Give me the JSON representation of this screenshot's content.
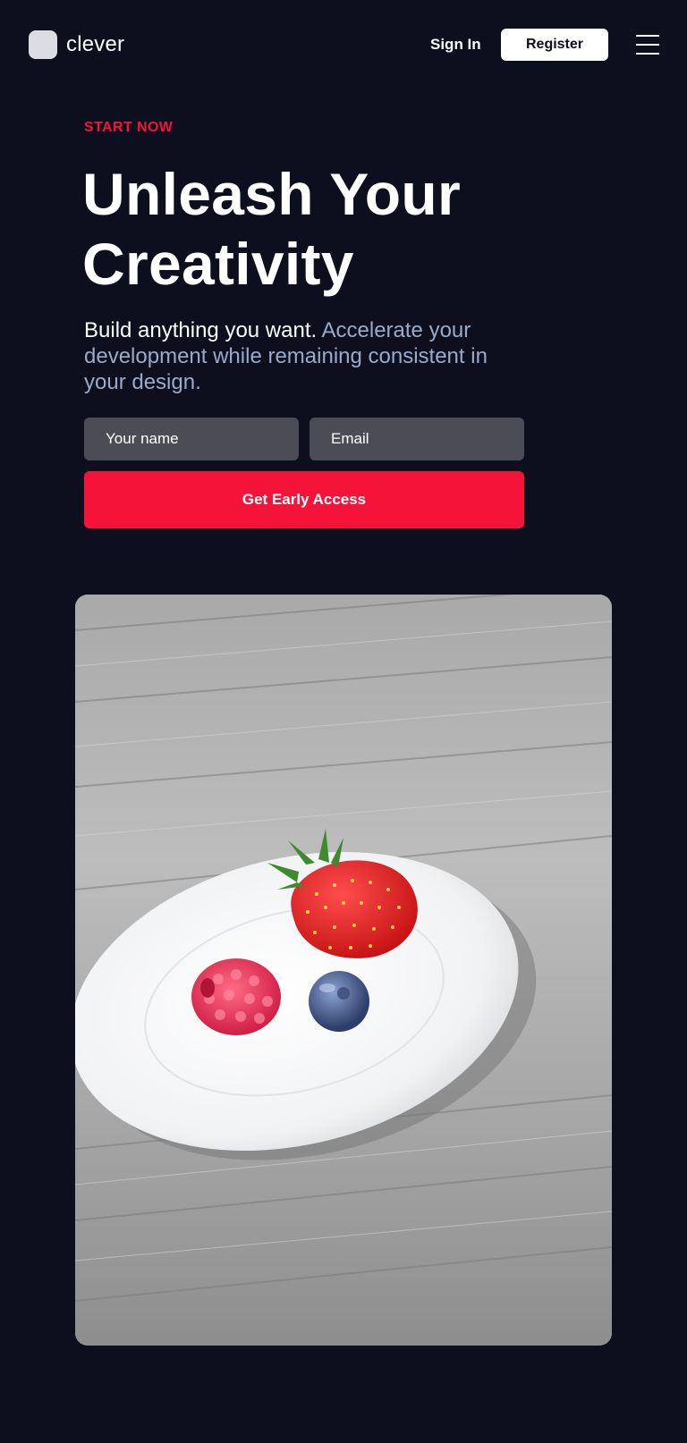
{
  "header": {
    "logo_text": "clever",
    "signin_label": "Sign In",
    "register_label": "Register"
  },
  "hero": {
    "eyebrow": "START NOW",
    "headline_line1": "Unleash Your",
    "headline_line2": "Creativity",
    "subtitle_lead": "Build anything you want.",
    "subtitle_rest": "Accelerate your development while remaining consistent in your design.",
    "name_placeholder": "Your name",
    "email_placeholder": "Email",
    "cta_label": "Get Early Access"
  },
  "icons": {
    "menu": "hamburger-menu-icon",
    "logo": "logo-mark-icon"
  },
  "colors": {
    "background": "#0d0f1e",
    "accent": "#f5133a",
    "subtitle_muted": "#9aabc8",
    "input_bg": "#4b4c56"
  }
}
